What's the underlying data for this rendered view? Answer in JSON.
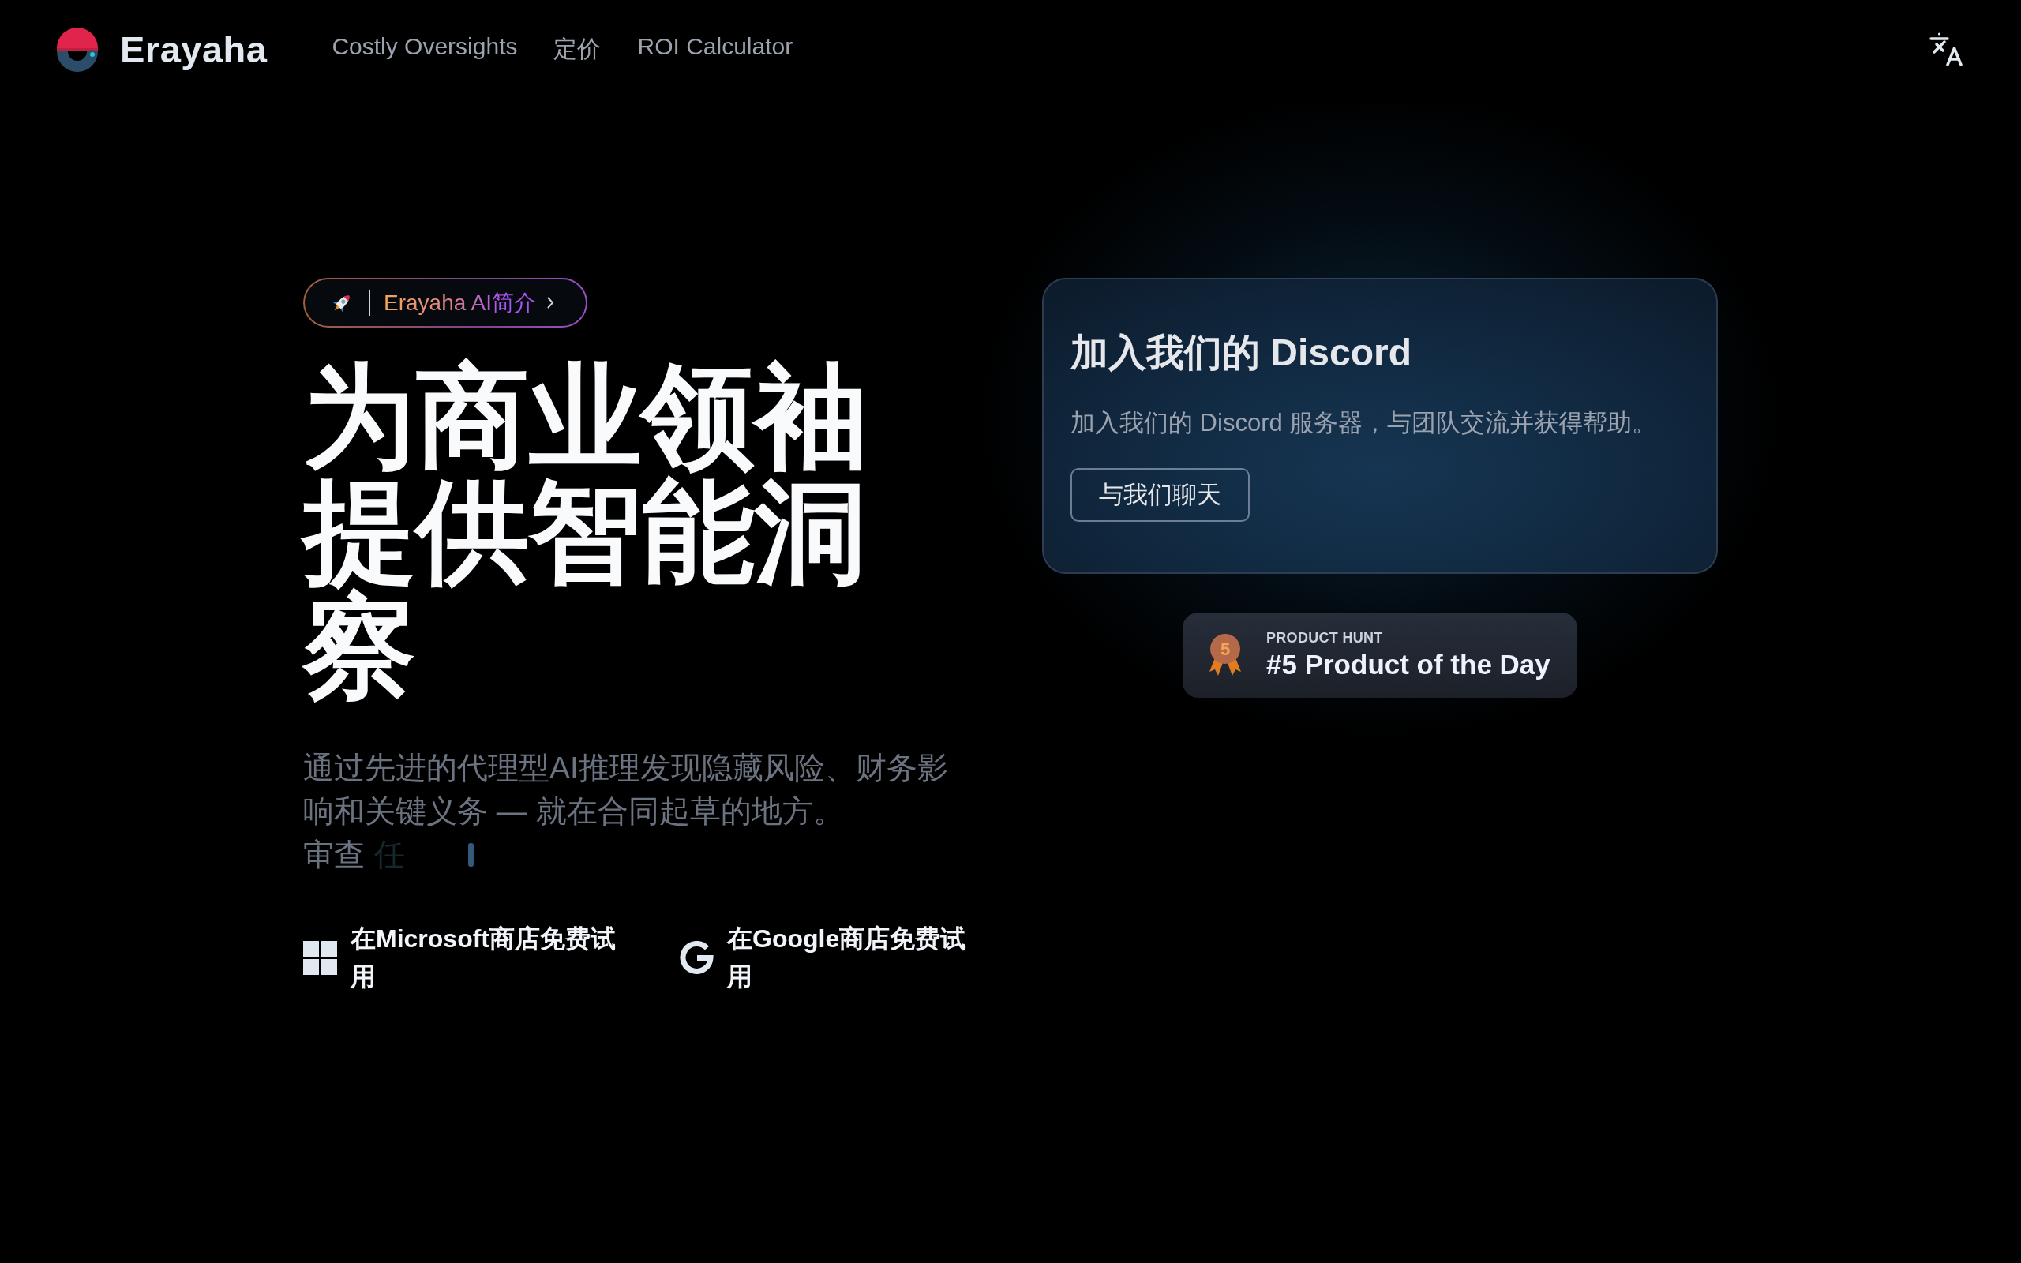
{
  "header": {
    "brand": "Erayaha",
    "nav": [
      {
        "label": "Costly Oversights"
      },
      {
        "label": "定价"
      },
      {
        "label": "ROI Calculator"
      }
    ]
  },
  "hero": {
    "badge": {
      "label": "Erayaha AI简介"
    },
    "headline": "为商业领袖提供智能洞察",
    "subtitle": "通过先进的代理型AI推理发现隐藏风险、财务影响和关键义务 — 就在合同起草的地方。",
    "typing": {
      "typed": "审查",
      "fading": "任"
    },
    "store_buttons": [
      {
        "kind": "microsoft",
        "label": "在Microsoft商店免费试用"
      },
      {
        "kind": "google",
        "label": "在Google商店免费试用"
      }
    ]
  },
  "discord_card": {
    "title": "加入我们的 Discord",
    "description": "加入我们的 Discord 服务器，与团队交流并获得帮助。",
    "button": "与我们聊天"
  },
  "product_hunt": {
    "medal": "5",
    "eyebrow": "PRODUCT HUNT",
    "title": "#5 Product of the Day"
  }
}
